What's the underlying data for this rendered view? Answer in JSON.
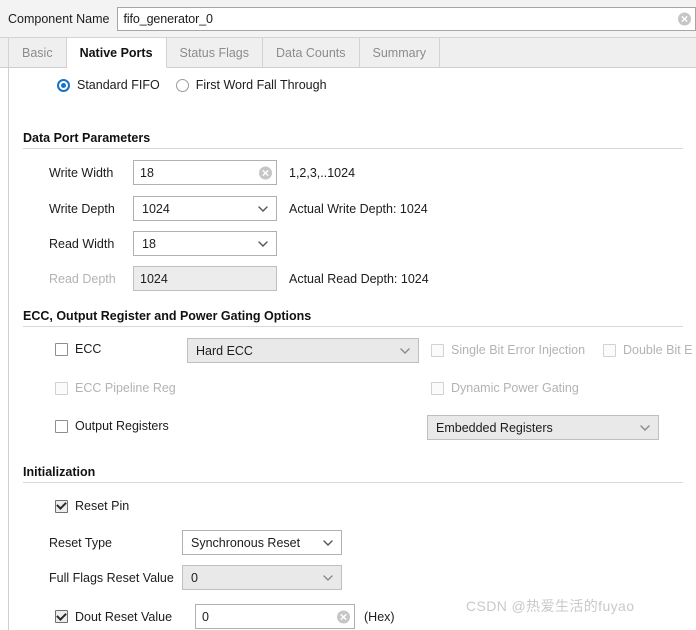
{
  "component_name": {
    "label": "Component Name",
    "value": "fifo_generator_0",
    "clear_icon": "clear-circle-icon"
  },
  "tabs": [
    {
      "label": "Basic",
      "active": false
    },
    {
      "label": "Native Ports",
      "active": true
    },
    {
      "label": "Status Flags",
      "active": false
    },
    {
      "label": "Data Counts",
      "active": false
    },
    {
      "label": "Summary",
      "active": false
    }
  ],
  "fifo_mode": {
    "options": [
      {
        "label": "Standard FIFO",
        "selected": true
      },
      {
        "label": "First Word Fall Through",
        "selected": false
      }
    ]
  },
  "data_port_parameters": {
    "title": "Data Port Parameters",
    "write_width": {
      "label": "Write Width",
      "value": "18",
      "hint": "1,2,3,..1024"
    },
    "write_depth": {
      "label": "Write Depth",
      "value": "1024",
      "hint": "Actual Write Depth: 1024"
    },
    "read_width": {
      "label": "Read Width",
      "value": "18",
      "hint": ""
    },
    "read_depth": {
      "label": "Read Depth",
      "value": "1024",
      "hint": "Actual Read Depth: 1024",
      "disabled": true
    }
  },
  "ecc_section": {
    "title": "ECC, Output Register and Power Gating Options",
    "ecc": {
      "label": "ECC",
      "checked": false
    },
    "ecc_type": {
      "value": "Hard ECC",
      "disabled": true
    },
    "single_bit_error_injection": {
      "label": "Single Bit Error Injection",
      "checked": false,
      "disabled": true
    },
    "double_bit_error_injection": {
      "label": "Double Bit E",
      "checked": false,
      "disabled": true
    },
    "ecc_pipeline_reg": {
      "label": "ECC Pipeline Reg",
      "checked": false,
      "disabled": true
    },
    "dynamic_power_gating": {
      "label": "Dynamic Power Gating",
      "checked": false,
      "disabled": true
    },
    "output_registers": {
      "label": "Output Registers",
      "checked": false
    },
    "output_register_type": {
      "value": "Embedded Registers",
      "disabled": true
    }
  },
  "initialization": {
    "title": "Initialization",
    "reset_pin": {
      "label": "Reset Pin",
      "checked": true
    },
    "reset_type": {
      "label": "Reset Type",
      "value": "Synchronous Reset"
    },
    "full_flags_reset_value": {
      "label": "Full Flags Reset Value",
      "value": "0",
      "disabled": true
    },
    "dout_reset_value": {
      "label": "Dout Reset Value",
      "value": "0",
      "checked": true,
      "hint": "(Hex)"
    }
  },
  "watermark": {
    "text": "CSDN @热爱生活的fuyao"
  },
  "colors": {
    "accent": "#1a72c4",
    "tab_bar_bg": "#efefef",
    "disabled_text": "#b3b3b3",
    "panel_bg": "#ffffff"
  }
}
